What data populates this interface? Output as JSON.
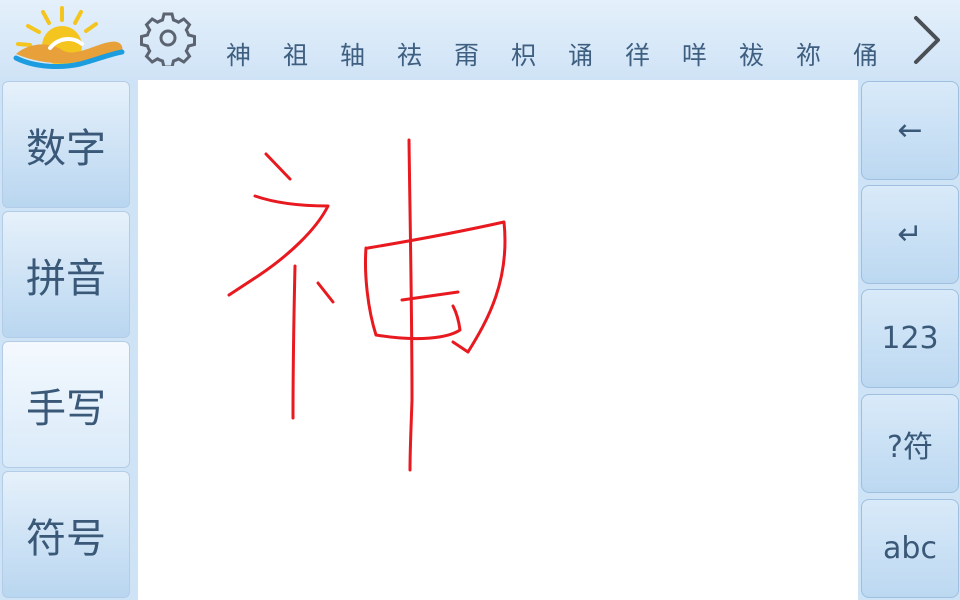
{
  "top_bar": {
    "candidates": [
      "神",
      "祖",
      "轴",
      "祛",
      "甭",
      "枳",
      "诵",
      "徉",
      "咩",
      "祓",
      "祢",
      "俑"
    ]
  },
  "modes": [
    {
      "label": "数字"
    },
    {
      "label": "拼音"
    },
    {
      "label": "手写",
      "active": true
    },
    {
      "label": "符号"
    }
  ],
  "keys": {
    "backspace": "←",
    "enter": "↵",
    "numbers": "123",
    "symbols": "?符",
    "letters": "abc"
  },
  "colors": {
    "ink": "#e8191f",
    "accent": "#3a5878",
    "background": "#cfe3f6"
  },
  "icons": [
    "sun-cloud-logo",
    "gear-icon",
    "chevron-right-icon"
  ]
}
